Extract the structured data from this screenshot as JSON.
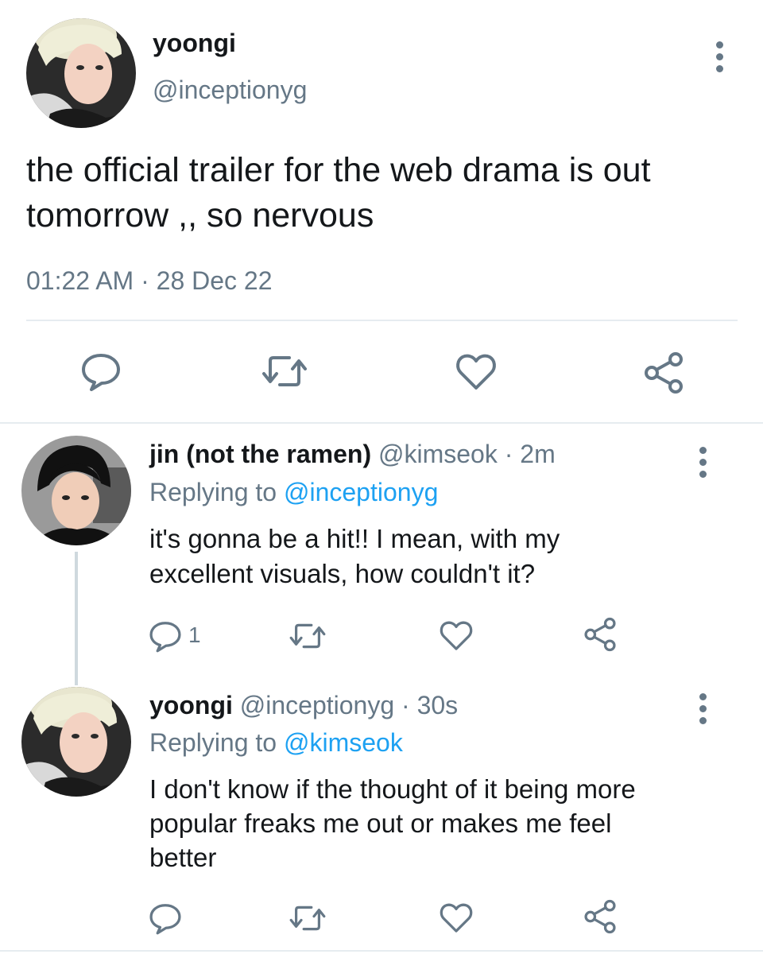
{
  "main_tweet": {
    "display_name": "yoongi",
    "handle": "@inceptionyg",
    "text_line1": "the official trailer for the web drama is out",
    "text_line2": "tomorrow ,, so nervous",
    "timestamp": "01:22 AM · 28 Dec 22",
    "avatar": "avatar-yoongi"
  },
  "replies": [
    {
      "display_name": "jin (not the ramen)",
      "handle": "@kimseok",
      "age": "· 2m",
      "replying_prefix": "Replying to",
      "replying_to": "@inceptionyg",
      "text_line1": "it's gonna be a hit!! I mean, with my",
      "text_line2": "excellent visuals, how couldn't it?",
      "reply_count": "1",
      "avatar": "avatar-jin"
    },
    {
      "display_name": "yoongi",
      "handle": "@inceptionyg",
      "age": "· 30s",
      "replying_prefix": "Replying to",
      "replying_to": "@kimseok",
      "text_line1": "I don't know if the thought of it being more",
      "text_line2": "popular freaks me out or makes me feel",
      "text_line3": "better",
      "avatar": "avatar-yoongi"
    }
  ],
  "icons": [
    "reply-icon",
    "retweet-icon",
    "like-icon",
    "share-icon",
    "more-options-icon"
  ],
  "colors": {
    "text": "#14171a",
    "secondary": "#657786",
    "link": "#1da1f2",
    "divider": "#e6ecf0"
  }
}
